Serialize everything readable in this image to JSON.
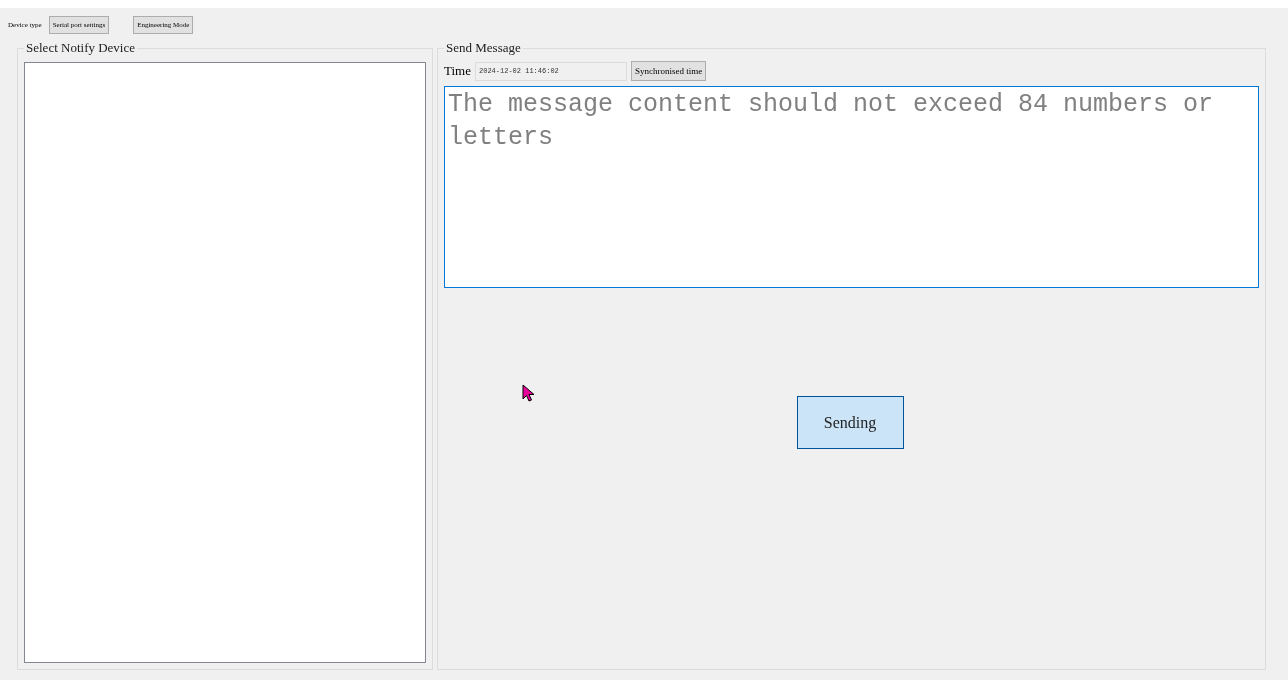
{
  "toolbar": {
    "label": "Device type",
    "buttons": [
      "Serial port settings",
      "Engineering Mode"
    ]
  },
  "notify_panel": {
    "title": "Select Notify Device"
  },
  "message_panel": {
    "title": "Send Message",
    "time_label": "Time",
    "time_value": "2024-12-02 11:46:02",
    "sync_button": "Synchronised time",
    "message_placeholder": "The message content should not exceed 84 numbers or letters",
    "send_button": "Sending"
  }
}
